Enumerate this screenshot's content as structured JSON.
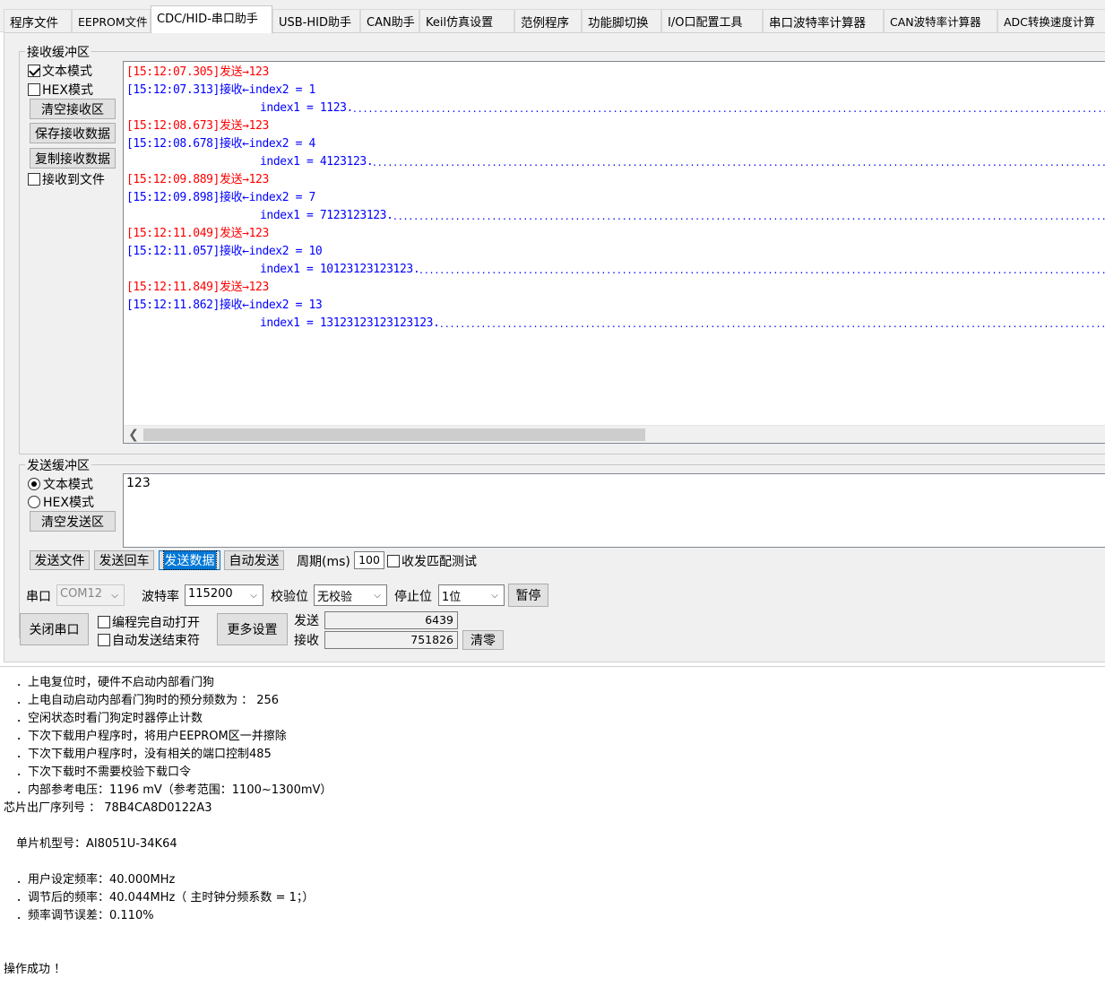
{
  "tabs": [
    {
      "label": "程序文件",
      "left": 0
    },
    {
      "label": "EEPROM文件",
      "left": 0
    },
    {
      "label": "CDC/HID-串口助手",
      "active": true
    },
    {
      "label": "USB-HID助手"
    },
    {
      "label": "CAN助手"
    },
    {
      "label": "Keil仿真设置"
    },
    {
      "label": "范例程序"
    },
    {
      "label": "功能脚切换"
    },
    {
      "label": "I/O口配置工具"
    },
    {
      "label": "串口波特率计算器"
    },
    {
      "label": "CAN波特率计算器"
    },
    {
      "label": "ADC转换速度计算"
    }
  ],
  "receive": {
    "title": "接收缓冲区",
    "text_mode_label": "文本模式",
    "text_mode_checked": true,
    "hex_mode_label": "HEX模式",
    "hex_mode_checked": false,
    "clear_button": "清空接收区",
    "save_button": "保存接收数据",
    "copy_button": "复制接收数据",
    "to_file_label": "接收到文件",
    "to_file_checked": false,
    "lines": [
      {
        "kind": "send",
        "text": "[15:12:07.305]发送→123"
      },
      {
        "kind": "recv",
        "text": "[15:12:07.313]接收←index2 = 1"
      },
      {
        "kind": "recv",
        "indent": true,
        "text": "index1 = 1123.",
        "dots": true
      },
      {
        "kind": "send",
        "text": "[15:12:08.673]发送→123"
      },
      {
        "kind": "recv",
        "text": "[15:12:08.678]接收←index2 = 4"
      },
      {
        "kind": "recv",
        "indent": true,
        "text": "index1 = 4123123.",
        "dots": true
      },
      {
        "kind": "send",
        "text": "[15:12:09.889]发送→123"
      },
      {
        "kind": "recv",
        "text": "[15:12:09.898]接收←index2 = 7"
      },
      {
        "kind": "recv",
        "indent": true,
        "text": "index1 = 7123123123.",
        "dots": true
      },
      {
        "kind": "send",
        "text": "[15:12:11.049]发送→123"
      },
      {
        "kind": "recv",
        "text": "[15:12:11.057]接收←index2 = 10"
      },
      {
        "kind": "recv",
        "indent": true,
        "text": "index1 = 10123123123123.",
        "dots": true
      },
      {
        "kind": "send",
        "text": "[15:12:11.849]发送→123"
      },
      {
        "kind": "recv",
        "text": "[15:12:11.862]接收←index2 = 13"
      },
      {
        "kind": "recv",
        "indent": true,
        "text": "index1 = 13123123123123123.",
        "dots": true
      }
    ]
  },
  "send": {
    "title": "发送缓冲区",
    "text_mode_label": "文本模式",
    "text_mode_checked": true,
    "hex_mode_label": "HEX模式",
    "hex_mode_checked": false,
    "clear_button": "清空发送区",
    "content": "123",
    "send_file_button": "发送文件",
    "send_enter_button": "发送回车",
    "send_data_button": "发送数据",
    "auto_send_button": "自动发送",
    "period_label": "周期(ms)",
    "period_value": "100",
    "match_test_label": "收发匹配测试",
    "match_test_checked": false
  },
  "port": {
    "port_label": "串口",
    "port_value": "COM12",
    "baud_label": "波特率",
    "baud_value": "115200",
    "parity_label": "校验位",
    "parity_value": "无校验",
    "stop_label": "停止位",
    "stop_value": "1位",
    "pause_button": "暂停",
    "close_button": "关闭串口",
    "auto_open_label": "编程完自动打开",
    "auto_open_checked": false,
    "auto_end_label": "自动发送结束符",
    "auto_end_checked": false,
    "more_button": "更多设置",
    "sent_label": "发送",
    "sent_value": "6439",
    "recv_label": "接收",
    "recv_value": "751826",
    "clear_button": "清零"
  },
  "log": [
    "．上电复位时，硬件不启动内部看门狗",
    "．上电自动启动内部看门狗时的预分频数为 ： 256",
    "．空闲状态时看门狗定时器停止计数",
    "．下次下载用户程序时，将用户EEPROM区一并擦除",
    "．下次下载用户程序时，没有相关的端口控制485",
    "．下次下载时不需要校验下载口令",
    "．内部参考电压：1196 mV（参考范围：1100~1300mV）",
    "芯片出厂序列号 ： 78B4CA8D0122A3",
    "",
    "单片机型号：AI8051U-34K64",
    "",
    "．用户设定频率：40.000MHz",
    "．调节后的频率：40.044MHz（ 主时钟分频系数 = 1；）",
    "．频率调节误差：0.110%",
    "",
    "",
    "操作成功 ！"
  ]
}
